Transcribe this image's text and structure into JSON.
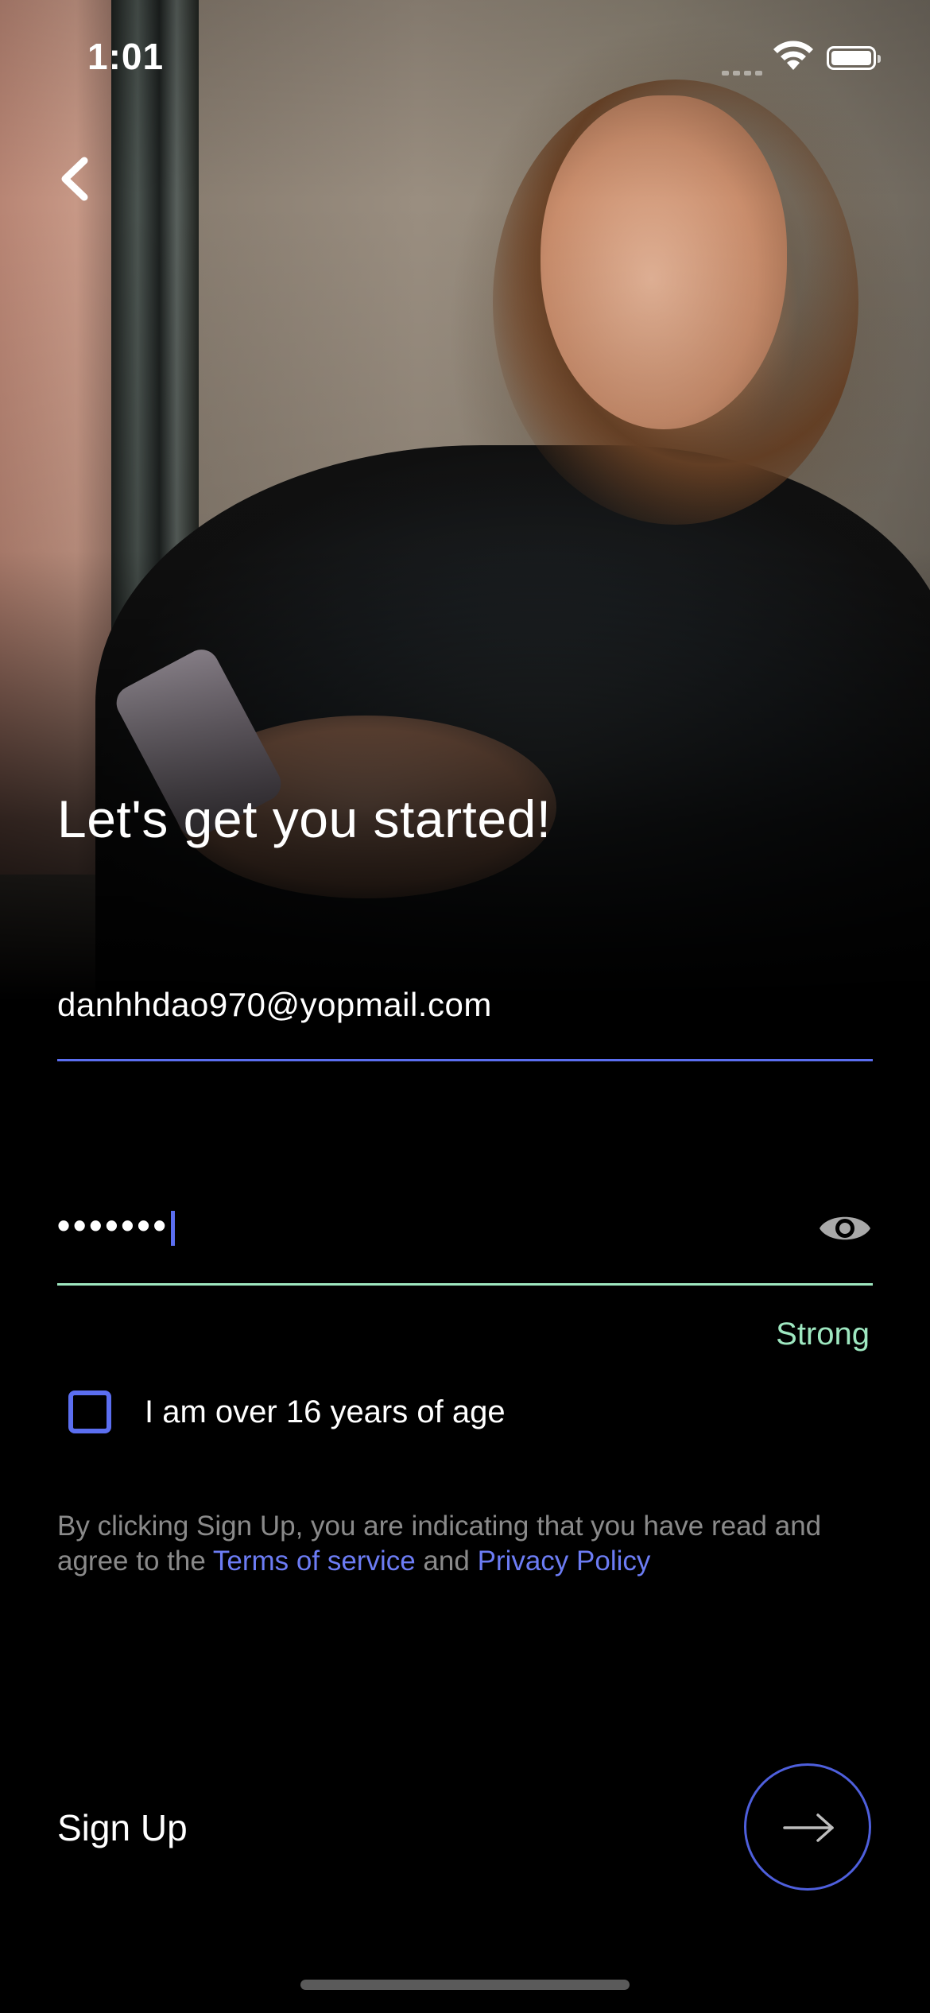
{
  "status_bar": {
    "time": "1:01"
  },
  "title": "Let's get you started!",
  "email": {
    "value": "danhhdao970@yopmail.com"
  },
  "password": {
    "masked_value": "•••••••",
    "strength": "Strong"
  },
  "age_check": {
    "label": "I am over 16 years of age",
    "checked": false
  },
  "legal": {
    "prefix": "By clicking Sign Up, you are indicating that you have read and agree to the",
    "terms_link": "Terms of service",
    "conjunction": "and",
    "privacy_link": "Privacy Policy"
  },
  "signup": {
    "label": "Sign Up"
  },
  "colors": {
    "accent": "#5b6ef0",
    "strong": "#9ee7c0",
    "background": "#000000"
  }
}
